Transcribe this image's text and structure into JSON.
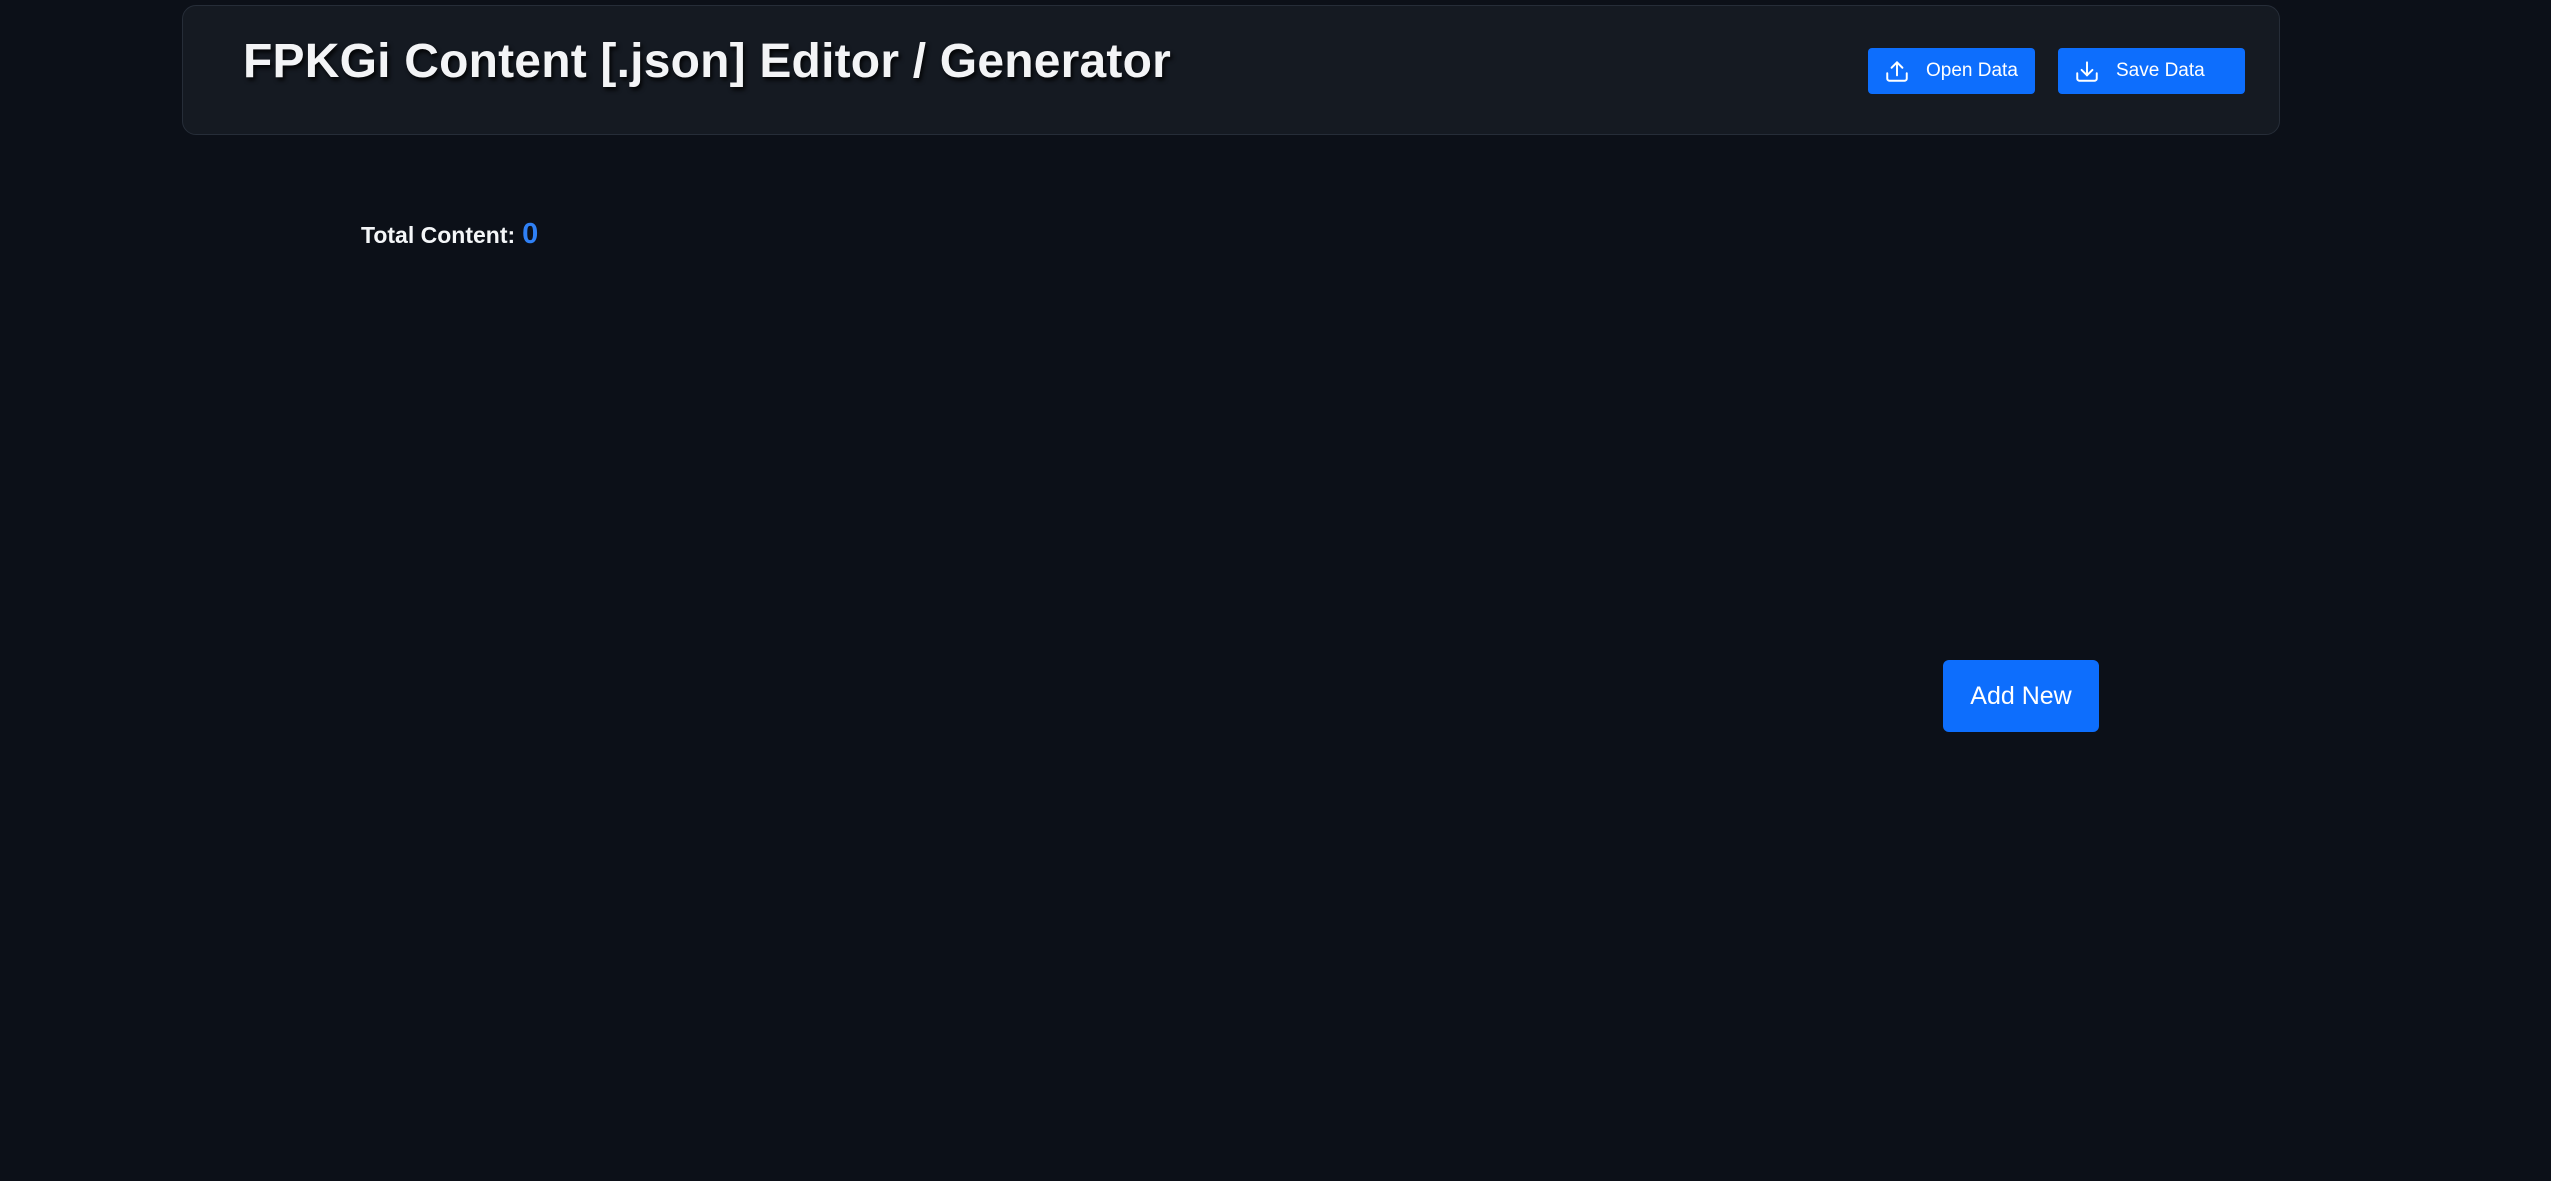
{
  "header": {
    "title": "FPKGi Content [.json] Editor / Generator",
    "open_button": {
      "label": "Open Data",
      "icon": "upload-icon"
    },
    "save_button": {
      "label": "Save Data",
      "icon": "download-icon"
    }
  },
  "summary": {
    "label": "Total Content:",
    "count": "0"
  },
  "actions": {
    "add_new_label": "Add New"
  },
  "colors": {
    "background": "#0c1018",
    "header_background": "#151a22",
    "accent": "#0d6efd",
    "count_color": "#2f80f5"
  }
}
